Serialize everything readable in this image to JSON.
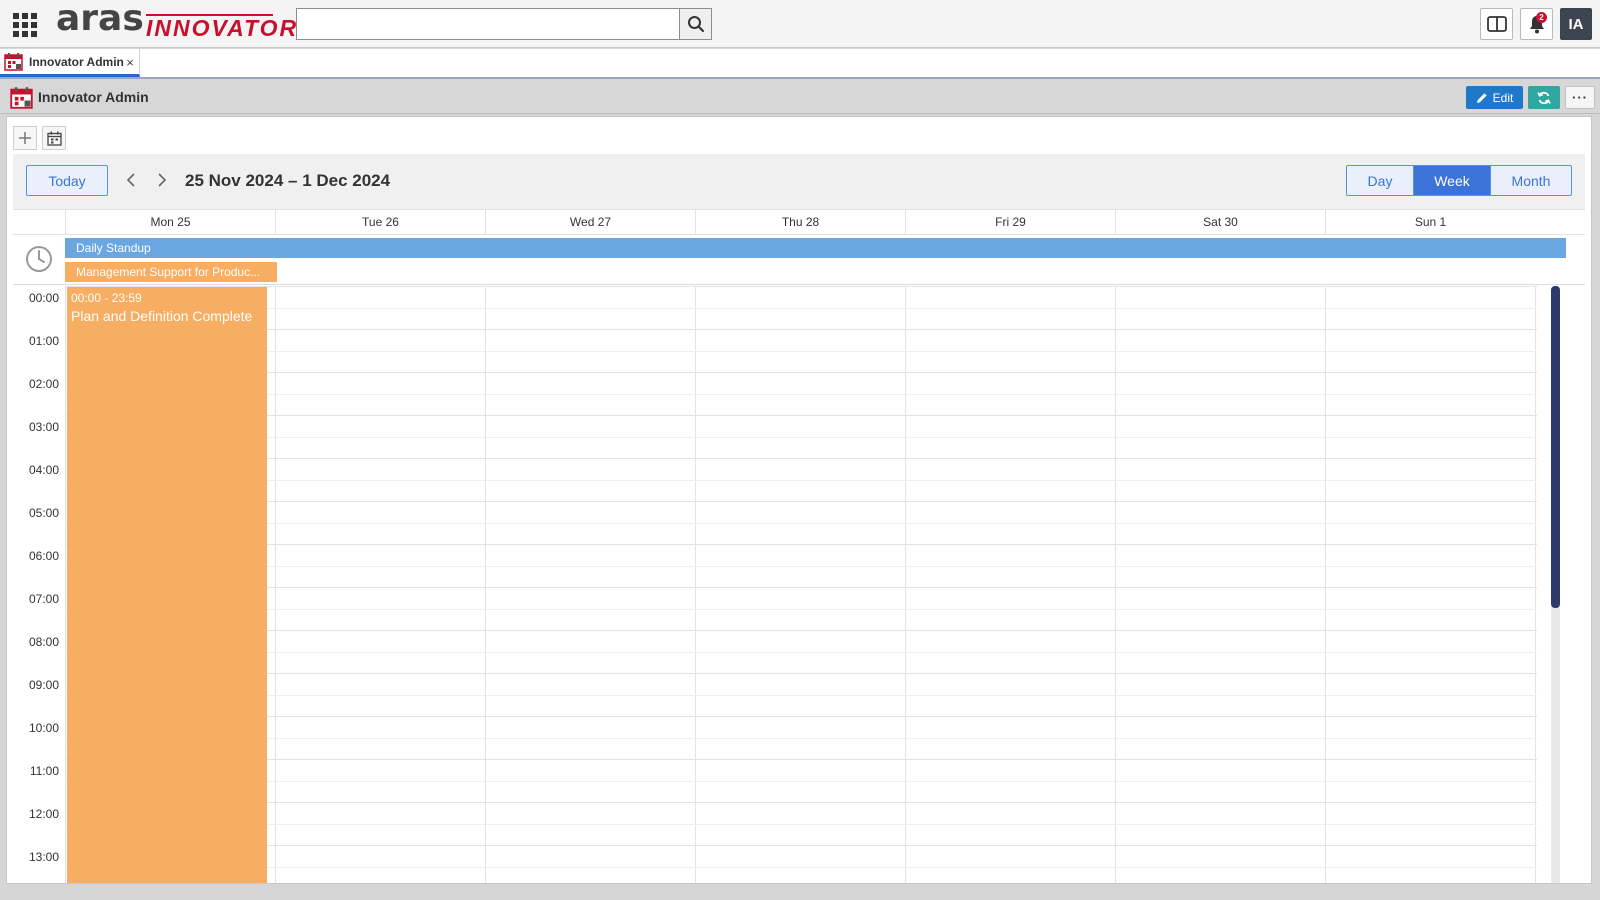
{
  "header": {
    "logo_primary": "aras",
    "logo_secondary": "INNOVATOR",
    "search": {
      "value": "",
      "placeholder": ""
    },
    "notifications_count": "2",
    "user_initials": "IA"
  },
  "tabs": [
    {
      "label": "Innovator Admin",
      "close": "×"
    }
  ],
  "item_bar": {
    "title": "Innovator Admin",
    "edit_label": "Edit",
    "more_label": "···"
  },
  "calendar": {
    "today_label": "Today",
    "range_label": "25 Nov 2024 – 1 Dec 2024",
    "views": [
      {
        "label": "Day",
        "active": false
      },
      {
        "label": "Week",
        "active": true
      },
      {
        "label": "Month",
        "active": false
      }
    ],
    "days": [
      "Mon 25",
      "Tue 26",
      "Wed 27",
      "Thu 28",
      "Fri 29",
      "Sat 30",
      "Sun 1"
    ],
    "all_day_events": [
      {
        "title": "Daily Standup",
        "color": "#6aa6e0"
      },
      {
        "title": "Management Support for Produc...",
        "color": "#f7ad62"
      }
    ],
    "hours": [
      "00:00",
      "01:00",
      "02:00",
      "03:00",
      "04:00",
      "05:00",
      "06:00",
      "07:00",
      "08:00",
      "09:00",
      "10:00",
      "11:00",
      "12:00",
      "13:00"
    ],
    "timed_events": [
      {
        "time": "00:00 - 23:59",
        "title": "Plan and Definition Complete",
        "color": "#f7ad62"
      }
    ]
  },
  "colors": {
    "accent": "#3b73d8",
    "edit": "#1e79c8",
    "refresh": "#2fa7a0",
    "brand_red": "#c8102e"
  }
}
